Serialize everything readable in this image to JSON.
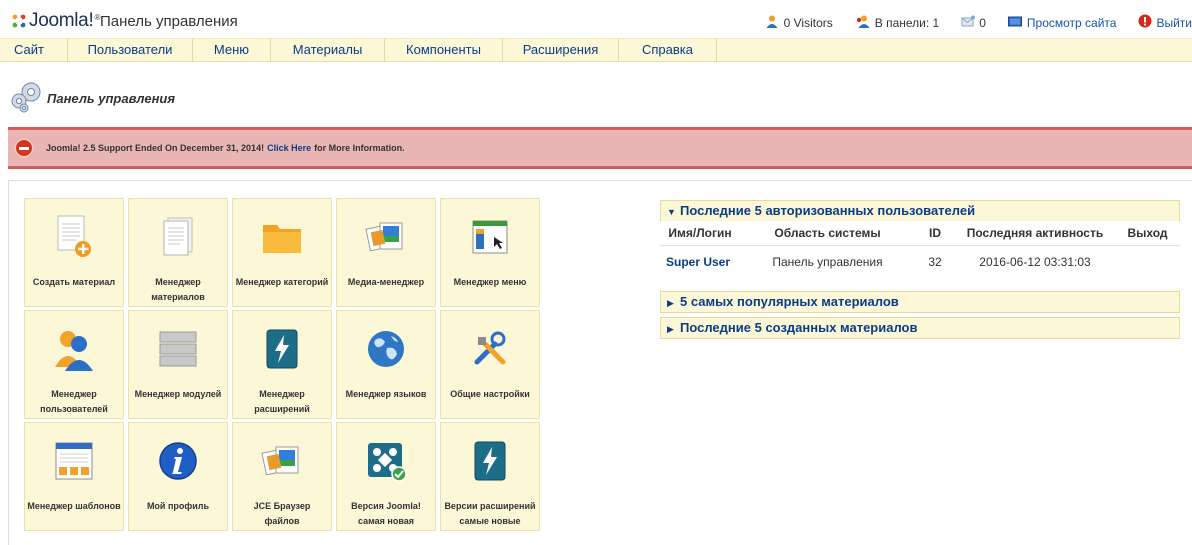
{
  "header": {
    "logo_text": "Joomla!",
    "logo_tm": "®",
    "site_title": "Панель управления",
    "status": {
      "visitors": "0 Visitors",
      "in_admin": "В панели: 1",
      "messages": "0",
      "view_site": "Просмотр сайта",
      "logout": "Выйти"
    }
  },
  "menu": [
    {
      "id": "site",
      "label": "Сайт"
    },
    {
      "id": "users",
      "label": "Пользователи"
    },
    {
      "id": "menus",
      "label": "Меню"
    },
    {
      "id": "content",
      "label": "Материалы"
    },
    {
      "id": "components",
      "label": "Компоненты"
    },
    {
      "id": "extensions",
      "label": "Расширения"
    },
    {
      "id": "help",
      "label": "Справка"
    }
  ],
  "page": {
    "title": "Панель управления"
  },
  "notice": {
    "text_before": "Joomla! 2.5 Support Ended On December 31, 2014!",
    "link_text": "Click Here",
    "text_after": "for More Information."
  },
  "tiles": [
    {
      "id": "create-article",
      "label": "Создать материал",
      "icon": "new-article-icon"
    },
    {
      "id": "article-manager",
      "label": "Менеджер материалов",
      "icon": "articles-icon"
    },
    {
      "id": "category-manager",
      "label": "Менеджер категорий",
      "icon": "folder-icon"
    },
    {
      "id": "media-manager",
      "label": "Медиа-менеджер",
      "icon": "media-icon"
    },
    {
      "id": "menu-manager",
      "label": "Менеджер меню",
      "icon": "menu-window-icon"
    },
    {
      "id": "user-manager",
      "label": "Менеджер пользователей",
      "icon": "users-icon"
    },
    {
      "id": "module-manager",
      "label": "Менеджер модулей",
      "icon": "modules-icon"
    },
    {
      "id": "extension-manager",
      "label": "Менеджер расширений",
      "icon": "extension-bolt-icon"
    },
    {
      "id": "language-manager",
      "label": "Менеджер языков",
      "icon": "globe-icon"
    },
    {
      "id": "global-config",
      "label": "Общие настройки",
      "icon": "tools-icon"
    },
    {
      "id": "template-manager",
      "label": "Менеджер шаблонов",
      "icon": "template-icon"
    },
    {
      "id": "my-profile",
      "label": "Мой профиль",
      "icon": "info-icon"
    },
    {
      "id": "jce-browser",
      "label": "JCE Браузер файлов",
      "icon": "media-icon"
    },
    {
      "id": "joomla-version",
      "label": "Версия Joomla! самая новая",
      "icon": "joomla-check-icon"
    },
    {
      "id": "extension-versions",
      "label": "Версии расширений самые новые",
      "icon": "extension-bolt-icon"
    }
  ],
  "modules": {
    "logged_users": {
      "title": "Последние 5 авторизованных пользователей",
      "columns": [
        "Имя/Логин",
        "Область системы",
        "ID",
        "Последняя активность",
        "Выход"
      ],
      "rows": [
        {
          "name": "Super User",
          "area": "Панель управления",
          "id": "32",
          "last_activity": "2016-06-12 03:31:03",
          "logout": ""
        }
      ]
    },
    "popular": {
      "title": "5 самых популярных материалов"
    },
    "latest": {
      "title": "Последние 5 созданных материалов"
    }
  },
  "colors": {
    "accent_blue": "#0b3d87",
    "menu_bg": "#fbf7d7",
    "notice_bg": "#e9b5b5",
    "notice_border": "#d35a5a"
  }
}
